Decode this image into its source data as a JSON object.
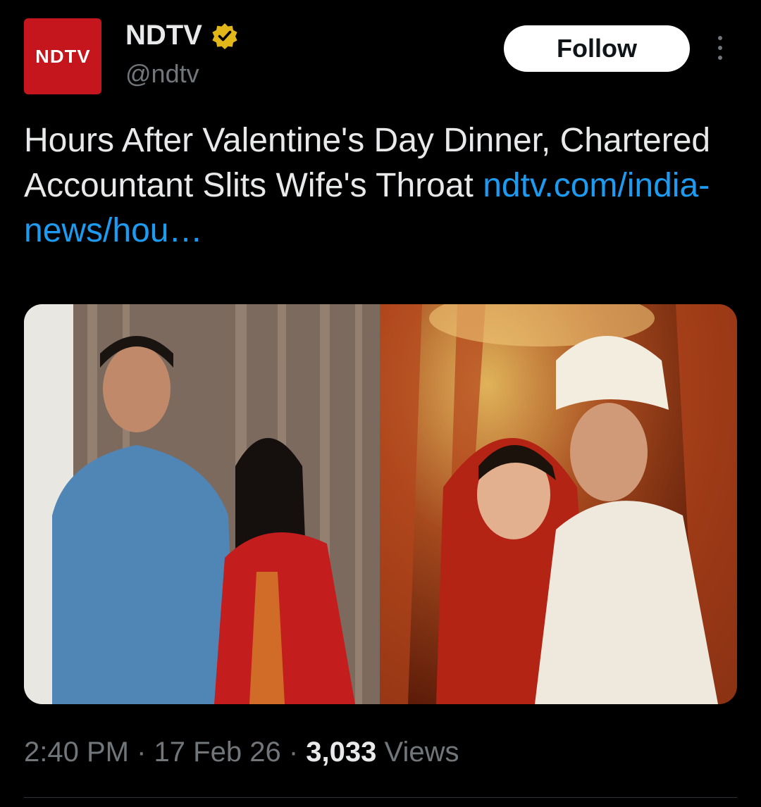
{
  "author": {
    "avatar_text": "NDTV",
    "display_name": "NDTV",
    "handle": "@ndtv",
    "verified_badge_icon": "gold-verified-badge-icon",
    "brand_color": "#c4161c"
  },
  "header": {
    "follow_label": "Follow",
    "more_icon": "vertical-ellipsis-icon"
  },
  "tweet": {
    "text": "Hours After Valentine's Day Dinner, Chartered Accountant Slits Wife's Throat ",
    "link": "ndtv.com/india-news/hou…",
    "link_color": "#1d9bf0"
  },
  "media": {
    "count": 2
  },
  "meta": {
    "time": "2:40 PM",
    "separator": "·",
    "date": "17 Feb 26",
    "views_count": "3,033",
    "views_label": "Views"
  },
  "colors": {
    "background": "#000000",
    "text_primary": "#e7e9ea",
    "text_secondary": "#71767b",
    "follow_bg": "#ffffff"
  }
}
